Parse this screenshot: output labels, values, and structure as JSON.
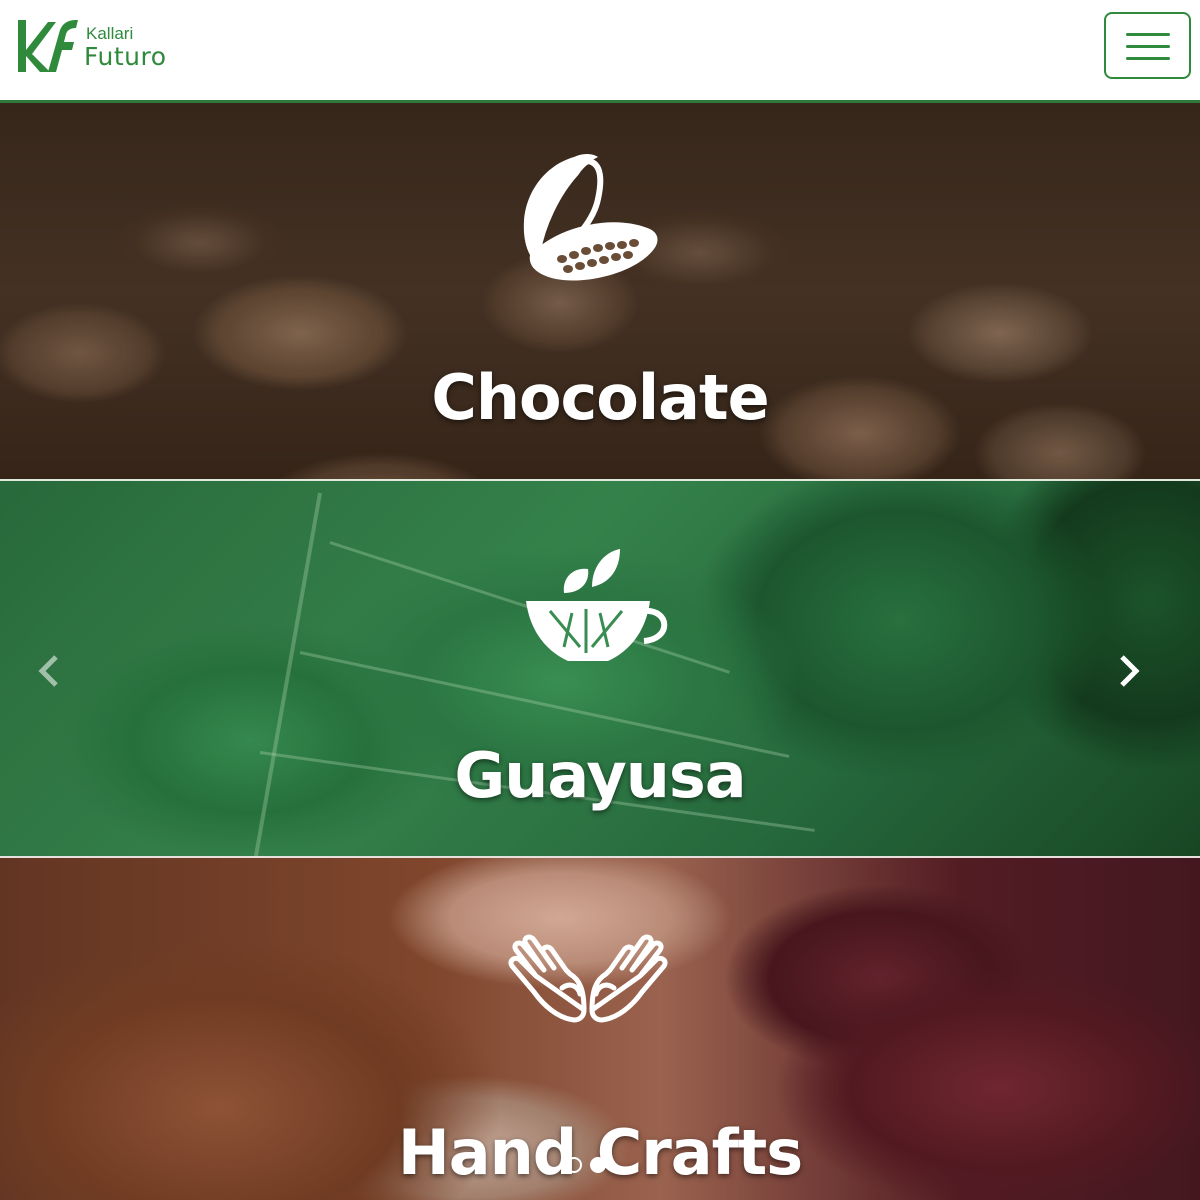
{
  "header": {
    "logo_small": "Kallari",
    "logo_big": "Futuro",
    "logo_mark": "kf",
    "menu_icon": "hamburger-menu-icon",
    "brand_color": "#2f8a3c"
  },
  "categories": [
    {
      "label": "Chocolate",
      "icon": "cacao-pod-icon"
    },
    {
      "label": "Guayusa",
      "icon": "tea-cup-leaves-icon"
    },
    {
      "label": "Hand Crafts",
      "icon": "open-hands-icon"
    }
  ],
  "carousel": {
    "prev_icon": "chevron-left-icon",
    "next_icon": "chevron-right-icon",
    "slide_count": 2,
    "active_slide": 2
  }
}
